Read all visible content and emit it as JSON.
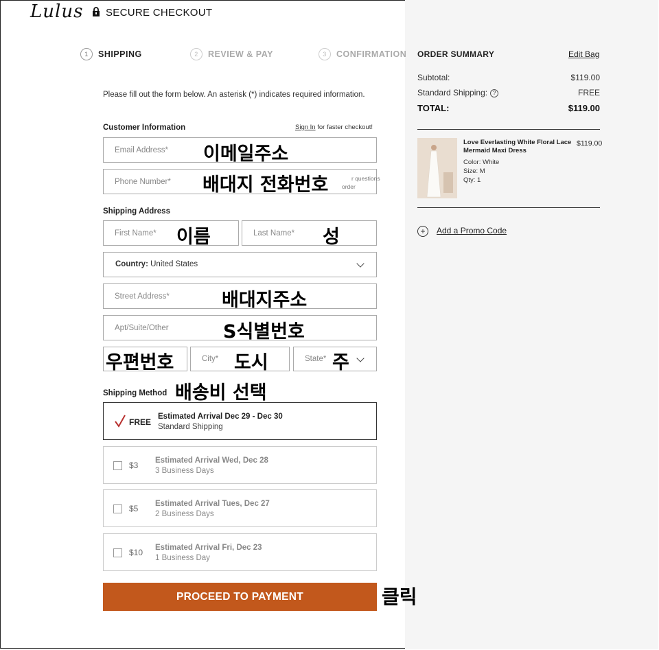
{
  "header": {
    "logo": "Lulus",
    "title": "SECURE CHECKOUT"
  },
  "steps": [
    {
      "num": "1",
      "label": "SHIPPING"
    },
    {
      "num": "2",
      "label": "REVIEW & PAY"
    },
    {
      "num": "3",
      "label": "CONFIRMATION"
    }
  ],
  "form": {
    "intro": "Please fill out the form below. An asterisk (*) indicates required information.",
    "customer_info_title": "Customer Information",
    "signin_link": "Sign In",
    "signin_suffix": " for faster checkout!",
    "email_placeholder": "Email Address*",
    "email_annotation": "이메일주소",
    "phone_placeholder": "Phone Number*",
    "phone_annotation": "배대지 전화번호",
    "phone_hint_1": "r questions",
    "phone_hint_2": "order",
    "shipping_address_title": "Shipping Address",
    "first_name_placeholder": "First Name*",
    "first_name_annotation": "이름",
    "last_name_placeholder": "Last Name*",
    "last_name_annotation": "성",
    "country_label": "Country:",
    "country_value": "United States",
    "street_placeholder": "Street Address*",
    "street_annotation": "배대지주소",
    "apt_placeholder": "Apt/Suite/Other",
    "apt_annotation": "S식별번호",
    "zip_annotation": "우편번호",
    "city_placeholder": "City*",
    "city_annotation": "도시",
    "state_placeholder": "State*",
    "state_annotation": "주",
    "shipping_method_title": "Shipping Method",
    "shipping_method_annotation": "배송비 선택"
  },
  "shipping_options": [
    {
      "price": "FREE",
      "arrival": "Estimated Arrival Dec 29 - Dec 30",
      "detail": "Standard Shipping",
      "selected": true
    },
    {
      "price": "$3",
      "arrival": "Estimated Arrival Wed, Dec 28",
      "detail": "3 Business Days",
      "selected": false
    },
    {
      "price": "$5",
      "arrival": "Estimated Arrival Tues, Dec 27",
      "detail": "2 Business Days",
      "selected": false
    },
    {
      "price": "$10",
      "arrival": "Estimated Arrival Fri, Dec 23",
      "detail": "1 Business Day",
      "selected": false
    }
  ],
  "proceed_button": "PROCEED TO PAYMENT",
  "click_annotation": "클릭",
  "order_summary": {
    "title": "ORDER SUMMARY",
    "edit_bag": "Edit Bag",
    "subtotal_label": "Subtotal:",
    "subtotal_value": "$119.00",
    "shipping_label": "Standard Shipping:",
    "shipping_value": "FREE",
    "total_label": "TOTAL:",
    "total_value": "$119.00",
    "product": {
      "name": "Love Everlasting White Floral Lace Mermaid Maxi Dress",
      "price": "$119.00",
      "color": "Color: White",
      "size": "Size: M",
      "qty": "Qty: 1"
    },
    "promo_link": "Add a Promo Code"
  },
  "colors": {
    "accent": "#c2581c",
    "checkmark": "#b8312f",
    "panel_bg": "#f5f5f5"
  }
}
